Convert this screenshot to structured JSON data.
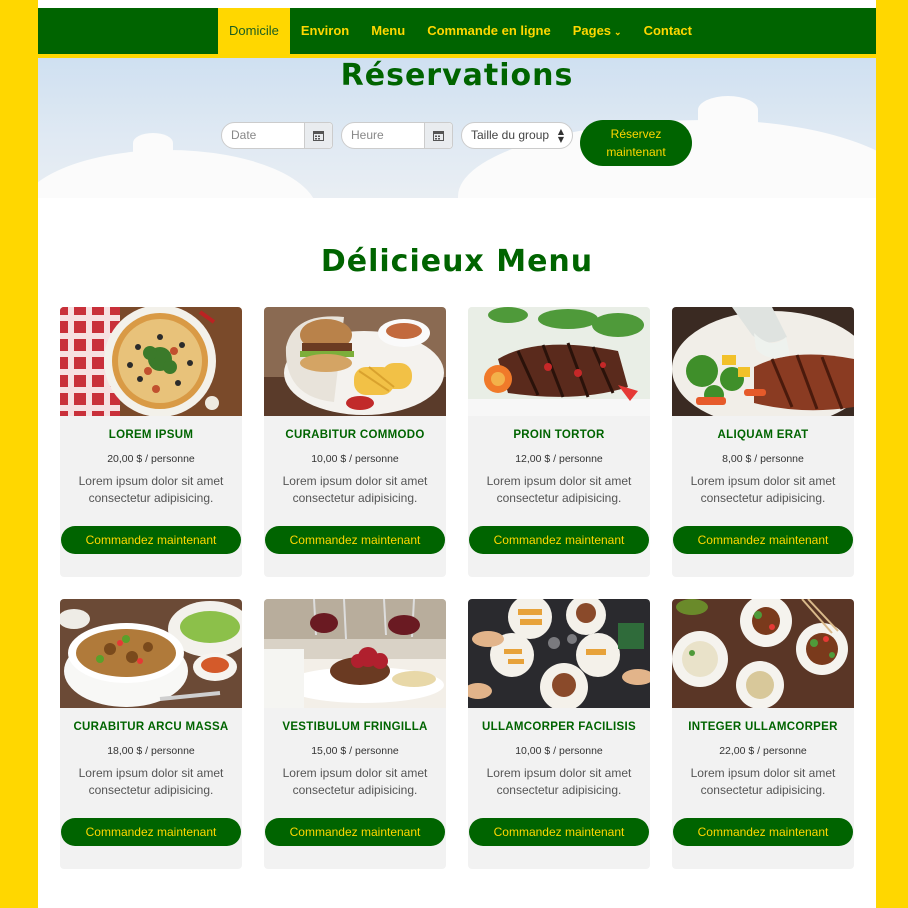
{
  "nav": {
    "items": [
      {
        "label": "Domicile",
        "active": true
      },
      {
        "label": "Environ"
      },
      {
        "label": "Menu"
      },
      {
        "label": "Commande en ligne"
      },
      {
        "label": "Pages",
        "dropdown": true
      },
      {
        "label": "Contact"
      }
    ]
  },
  "reservation": {
    "title": "Réservations",
    "date_placeholder": "Date",
    "time_placeholder": "Heure",
    "group_placeholder": "Taille du group",
    "button_line1": "Réservez",
    "button_line2": "maintenant"
  },
  "menu": {
    "title": "Délicieux Menu",
    "order_label": "Commandez maintenant",
    "items": [
      {
        "name": "LOREM IPSUM",
        "price": "20,00 $ / personne",
        "desc": "Lorem ipsum dolor sit amet consectetur adipisicing.",
        "image": "pizza"
      },
      {
        "name": "CURABITUR COMMODO",
        "price": "10,00 $ / personne",
        "desc": "Lorem ipsum dolor sit amet consectetur adipisicing.",
        "image": "burger-fries"
      },
      {
        "name": "PROIN TORTOR",
        "price": "12,00 $ / personne",
        "desc": "Lorem ipsum dolor sit amet consectetur adipisicing.",
        "image": "grilled-steak"
      },
      {
        "name": "ALIQUAM ERAT",
        "price": "8,00 $ / personne",
        "desc": "Lorem ipsum dolor sit amet consectetur adipisicing.",
        "image": "steak-vegetables"
      },
      {
        "name": "CURABITUR ARCU MASSA",
        "price": "18,00 $ / personne",
        "desc": "Lorem ipsum dolor sit amet consectetur adipisicing.",
        "image": "soup-bowl"
      },
      {
        "name": "VESTIBULUM FRINGILLA",
        "price": "15,00 $ / personne",
        "desc": "Lorem ipsum dolor sit amet consectetur adipisicing.",
        "image": "fine-dining"
      },
      {
        "name": "ULLAMCORPER FACILISIS",
        "price": "10,00 $ / personne",
        "desc": "Lorem ipsum dolor sit amet consectetur adipisicing.",
        "image": "shared-table"
      },
      {
        "name": "INTEGER ULLAMCORPER",
        "price": "22,00 $ / personne",
        "desc": "Lorem ipsum dolor sit amet consectetur adipisicing.",
        "image": "asian-dishes"
      }
    ]
  },
  "colors": {
    "brand_green": "#006400",
    "accent_yellow": "#FFD700"
  }
}
